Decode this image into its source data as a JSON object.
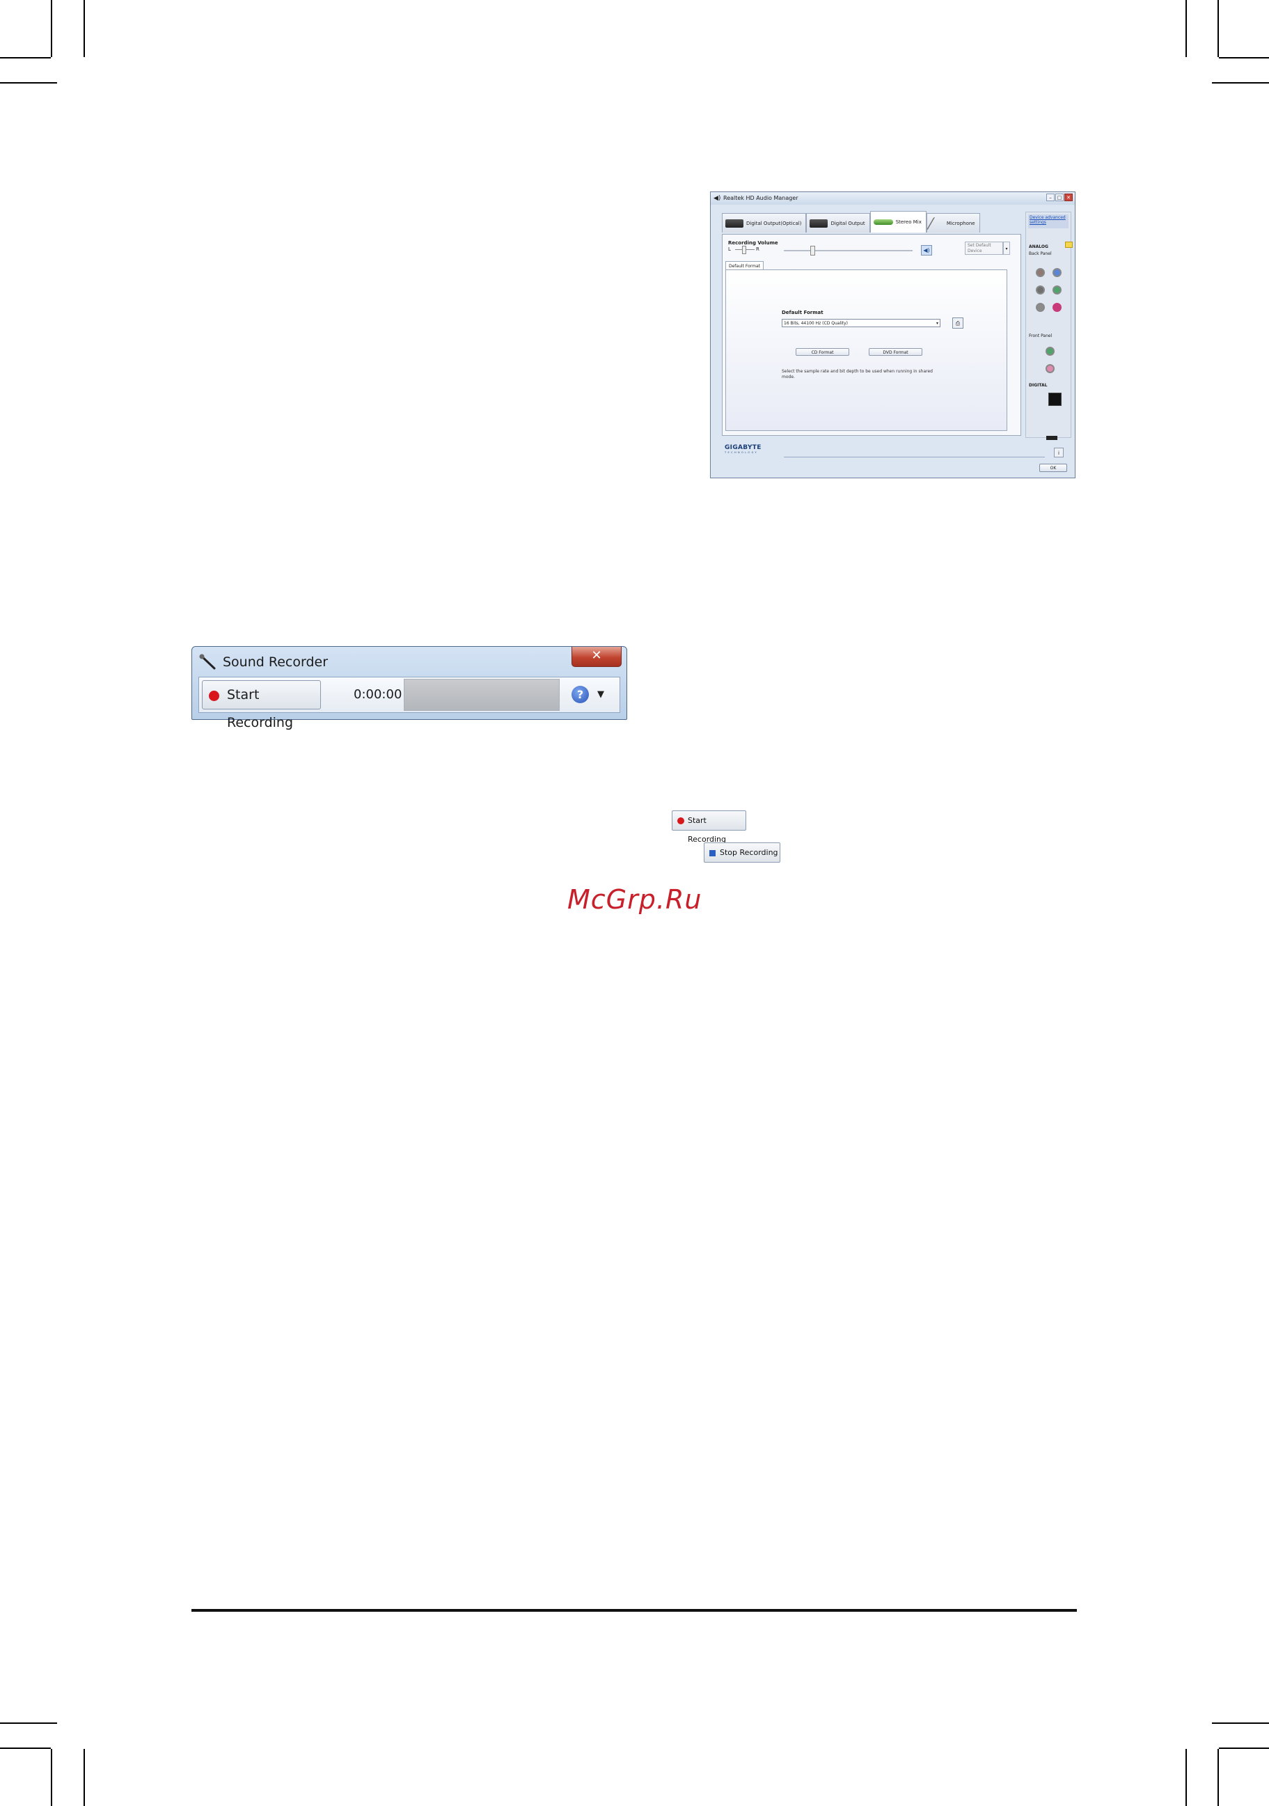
{
  "realtek": {
    "title": "Realtek HD Audio Manager",
    "tabs": [
      "Digital Output(Optical)",
      "Digital Output",
      "Stereo Mix",
      "Microphone"
    ],
    "recording_volume_label": "Recording Volume",
    "left_label": "L",
    "right_label": "R",
    "set_default_device": "Set Default Device",
    "subtab": "Default Format",
    "default_format_label": "Default Format",
    "format_value": "16 Bits, 44100 Hz (CD Quality)",
    "cd_format": "CD Format",
    "dvd_format": "DVD Format",
    "description": "Select the sample rate and bit depth to be used when running in shared mode.",
    "device_advanced_settings": "Device advanced settings",
    "analog": "ANALOG",
    "back_panel": "Back Panel",
    "front_panel": "Front Panel",
    "digital": "DIGITAL",
    "logo": "GIGABYTE",
    "logo_sub": "TECHNOLOGY",
    "ok": "OK"
  },
  "recorder": {
    "title": "Sound Recorder",
    "close": "✕",
    "start_recording": "Start Recording",
    "time": "0:00:00",
    "help": "?",
    "dropdown": "▼"
  },
  "buttons": {
    "start_recording": "Start Recording",
    "stop_recording": "Stop Recording"
  },
  "watermark": "McGrp.Ru",
  "colors": {
    "record_red": "#d8161c",
    "stop_blue": "#2b5fc2",
    "watermark_red": "#c8202a",
    "jack_back": [
      "#8e7a70",
      "#5b86d6",
      "#6f6f6f",
      "#4fa46a",
      "#8b8b8b",
      "#c83a7a"
    ],
    "jack_front": [
      "#4fa46a",
      "#e08ab0"
    ]
  }
}
